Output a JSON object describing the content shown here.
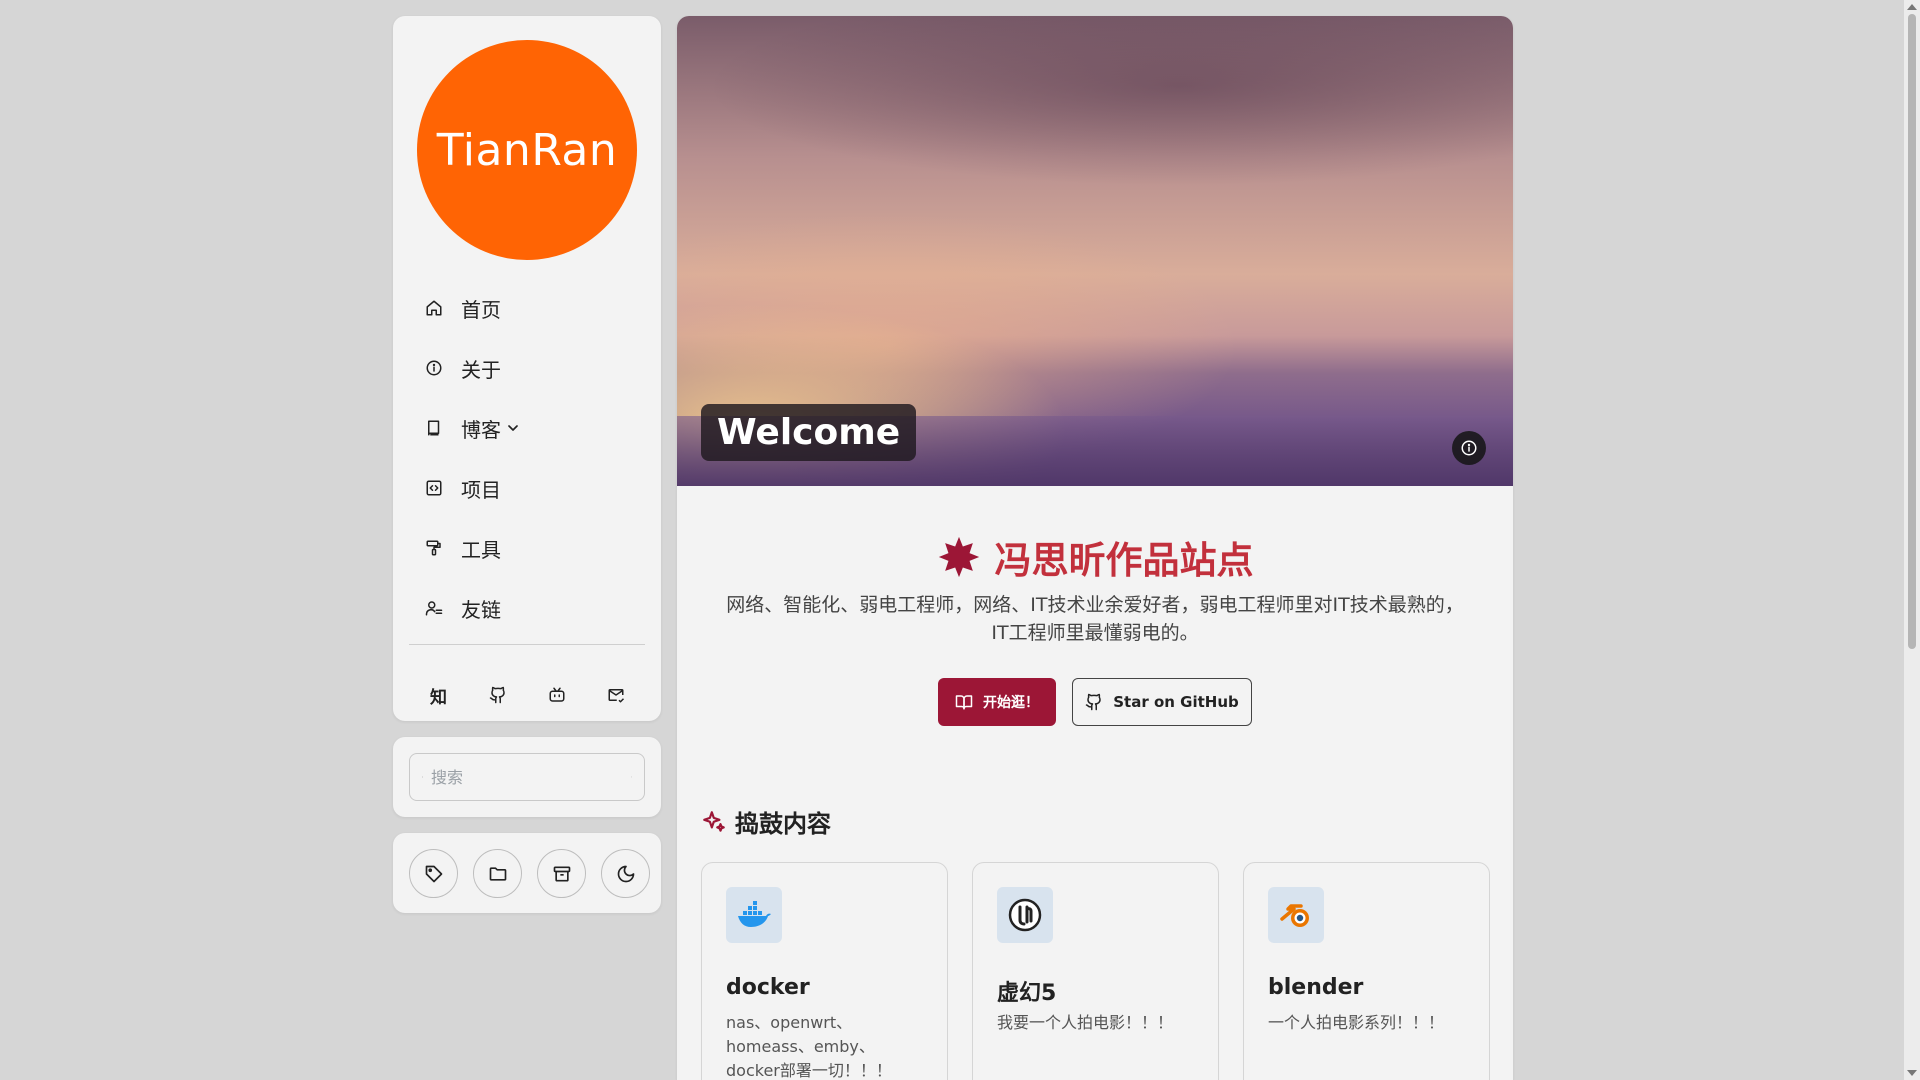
{
  "brand": {
    "logo_text": "TianRan",
    "accent": "#ff6404"
  },
  "nav": {
    "items": [
      {
        "label": "首页",
        "icon": "home-icon"
      },
      {
        "label": "关于",
        "icon": "info-icon"
      },
      {
        "label": "博客",
        "icon": "book-icon",
        "has_dropdown": true
      },
      {
        "label": "项目",
        "icon": "code-icon"
      },
      {
        "label": "工具",
        "icon": "paint-roller-icon"
      },
      {
        "label": "友链",
        "icon": "users-icon"
      }
    ]
  },
  "socials": [
    {
      "name": "zhihu",
      "label": "知"
    },
    {
      "name": "github"
    },
    {
      "name": "bilibili"
    },
    {
      "name": "email"
    }
  ],
  "search": {
    "placeholder": "搜索"
  },
  "tools": [
    "tag-icon",
    "folder-icon",
    "archive-icon",
    "moon-icon"
  ],
  "hero": {
    "title": "Welcome"
  },
  "intro": {
    "title": "冯思昕作品站点",
    "title_color": "#c2303c",
    "description": "网络、智能化、弱电工程师，网络、IT技术业余爱好者，弱电工程师里对IT技术最熟的，IT工程师里最懂弱电的。",
    "start_button": "开始逛！",
    "github_button": "Star on GitHub",
    "button_color": "#9c1636"
  },
  "projects": {
    "section_title": "捣鼓内容",
    "items": [
      {
        "name": "docker",
        "description": "nas、openwrt、homeass、emby、docker部署一切！！！",
        "icon": "docker-icon"
      },
      {
        "name": "虚幻5",
        "description": "我要一个人拍电影！！！",
        "icon": "unreal-icon"
      },
      {
        "name": "blender",
        "description": "一个人拍电影系列！！！",
        "icon": "blender-icon"
      }
    ]
  }
}
